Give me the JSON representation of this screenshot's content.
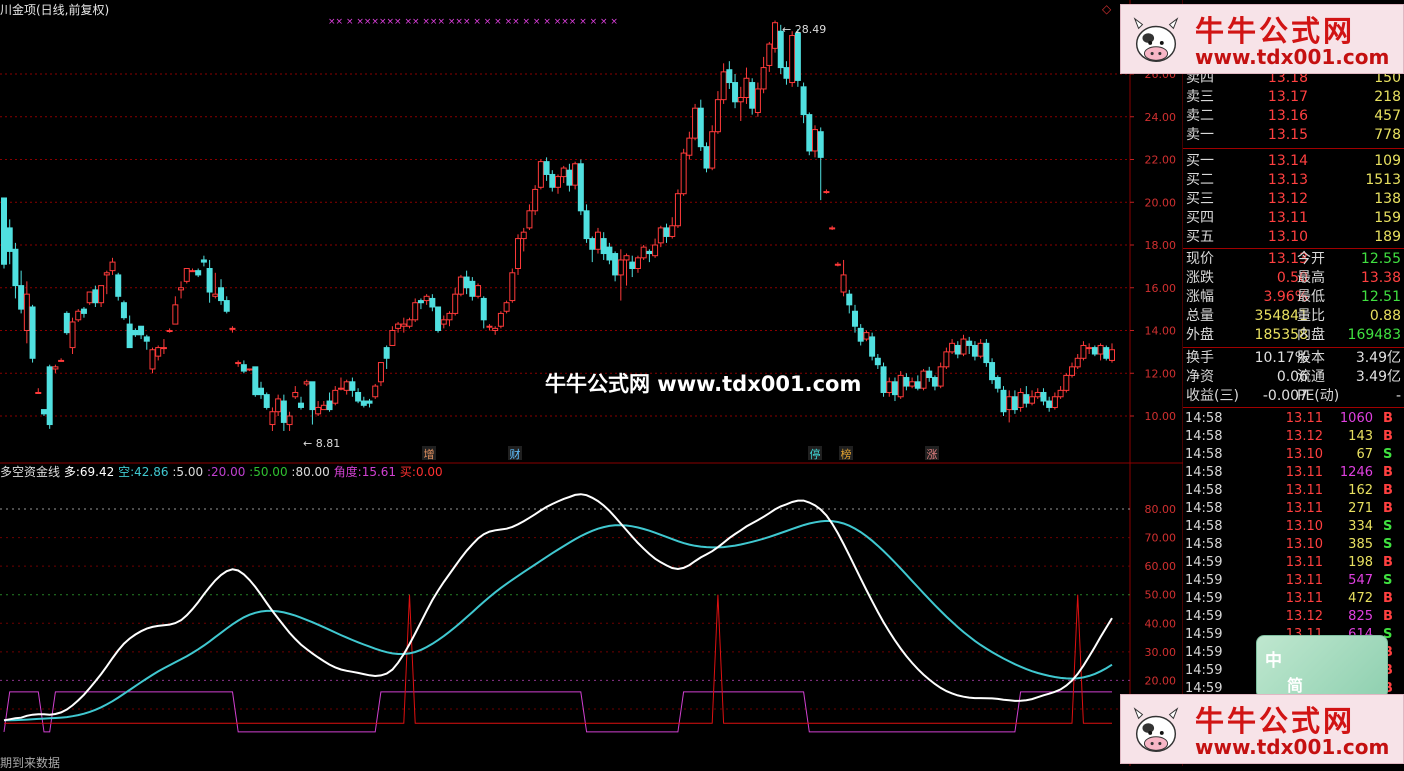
{
  "header": {
    "title": "川金项(日线,前复权)"
  },
  "main_chart": {
    "high_label": "28.49",
    "low_label": "8.81",
    "price_axis": [
      "26.00",
      "24.00",
      "22.00",
      "20.00",
      "18.00",
      "16.00",
      "14.00",
      "12.00",
      "10.00"
    ],
    "event_markers": [
      "增",
      "财",
      "停",
      "榜",
      "涨"
    ],
    "top_markers": "×× × ×××××× ×× ××× ××× × × × ×× × × × ××× × × × ×",
    "candles": [
      [
        20.2,
        17.1,
        20.2,
        16.9
      ],
      [
        18.8,
        17.7,
        19.2,
        17.1
      ],
      [
        17.8,
        16.1,
        18.1,
        15.5
      ],
      [
        16.1,
        15.0,
        16.8,
        14.8
      ],
      [
        14.0,
        15.7,
        16.3,
        13.4
      ],
      [
        15.1,
        12.7,
        15.2,
        12.5
      ],
      [
        11.1,
        11.1,
        11.3,
        11.1
      ],
      [
        10.3,
        10.1,
        10.3,
        10.0
      ],
      [
        12.3,
        9.6,
        12.4,
        9.4
      ],
      [
        12.2,
        12.3,
        12.4,
        12.0
      ],
      [
        12.6,
        12.6,
        12.7,
        12.6
      ],
      [
        14.8,
        13.9,
        14.9,
        13.8
      ],
      [
        13.2,
        14.4,
        14.6,
        12.9
      ],
      [
        14.5,
        14.9,
        15.0,
        14.4
      ],
      [
        15.0,
        14.8,
        15.1,
        14.6
      ],
      [
        15.3,
        15.8,
        15.8,
        15.2
      ],
      [
        15.9,
        15.3,
        16.1,
        15.1
      ],
      [
        15.3,
        16.1,
        16.1,
        15.1
      ],
      [
        16.6,
        16.7,
        16.8,
        15.7
      ],
      [
        16.8,
        17.2,
        17.4,
        16.6
      ],
      [
        16.6,
        15.6,
        16.7,
        15.4
      ],
      [
        15.3,
        14.6,
        15.4,
        14.5
      ],
      [
        14.3,
        13.2,
        14.7,
        13.2
      ],
      [
        14.0,
        13.8,
        14.1,
        13.7
      ],
      [
        14.2,
        13.8,
        14.2,
        13.6
      ],
      [
        13.7,
        13.5,
        13.8,
        13.1
      ],
      [
        12.2,
        13.1,
        13.2,
        12.0
      ],
      [
        12.8,
        13.2,
        13.3,
        12.6
      ],
      [
        13.2,
        13.2,
        13.6,
        12.9
      ],
      [
        14.0,
        14.0,
        14.1,
        13.9
      ],
      [
        14.3,
        15.2,
        15.6,
        14.3
      ],
      [
        15.9,
        16.0,
        16.3,
        15.5
      ],
      [
        16.3,
        16.9,
        16.9,
        16.2
      ],
      [
        16.8,
        16.8,
        16.9,
        16.8
      ],
      [
        16.8,
        16.6,
        16.9,
        16.5
      ],
      [
        17.3,
        17.2,
        17.5,
        17.0
      ],
      [
        16.9,
        15.8,
        17.3,
        15.3
      ],
      [
        15.6,
        15.7,
        16.7,
        15.5
      ],
      [
        16.0,
        15.4,
        16.4,
        15.2
      ],
      [
        15.4,
        14.9,
        15.6,
        14.8
      ],
      [
        14.1,
        14.1,
        14.2,
        13.9
      ],
      [
        12.5,
        12.5,
        12.6,
        12.3
      ],
      [
        12.4,
        12.1,
        12.6,
        12.0
      ],
      [
        12.2,
        12.2,
        12.2,
        12.1
      ],
      [
        12.3,
        11.0,
        12.3,
        10.9
      ],
      [
        11.3,
        11.0,
        11.6,
        10.8
      ],
      [
        11.0,
        10.4,
        11.1,
        10.3
      ],
      [
        9.6,
        10.2,
        10.4,
        9.3
      ],
      [
        10.2,
        10.8,
        11.0,
        10.0
      ],
      [
        10.7,
        9.7,
        11.0,
        9.3
      ],
      [
        9.6,
        10.0,
        10.2,
        9.3
      ],
      [
        10.9,
        11.1,
        11.4,
        10.8
      ],
      [
        10.6,
        10.4,
        10.9,
        10.3
      ],
      [
        11.5,
        11.6,
        11.7,
        11.4
      ],
      [
        11.6,
        10.3,
        11.6,
        9.6
      ],
      [
        10.1,
        10.4,
        10.7,
        10.0
      ],
      [
        10.3,
        10.5,
        10.7,
        10.3
      ],
      [
        10.7,
        10.3,
        11.1,
        10.2
      ],
      [
        10.6,
        11.2,
        11.4,
        10.5
      ],
      [
        11.3,
        11.3,
        11.8,
        11.2
      ],
      [
        11.2,
        11.6,
        11.7,
        11.0
      ],
      [
        11.6,
        11.2,
        11.8,
        10.9
      ],
      [
        11.1,
        10.7,
        11.3,
        10.6
      ],
      [
        10.7,
        10.5,
        10.9,
        10.4
      ],
      [
        10.7,
        10.6,
        10.8,
        10.4
      ],
      [
        10.9,
        11.4,
        11.5,
        10.8
      ],
      [
        11.6,
        12.5,
        12.5,
        11.4
      ],
      [
        13.2,
        12.7,
        13.3,
        12.2
      ],
      [
        13.3,
        14.0,
        14.2,
        13.3
      ],
      [
        14.1,
        14.3,
        14.4,
        13.9
      ],
      [
        14.2,
        14.3,
        14.6,
        13.9
      ],
      [
        14.2,
        14.5,
        14.6,
        14.1
      ],
      [
        14.5,
        15.3,
        15.5,
        14.4
      ],
      [
        15.4,
        15.3,
        15.5,
        15.0
      ],
      [
        15.4,
        15.6,
        15.7,
        15.2
      ],
      [
        15.5,
        15.1,
        15.7,
        14.9
      ],
      [
        15.1,
        14.0,
        15.1,
        13.9
      ],
      [
        14.3,
        14.5,
        14.7,
        14.1
      ],
      [
        14.5,
        14.8,
        14.9,
        14.2
      ],
      [
        14.8,
        15.7,
        16.0,
        14.7
      ],
      [
        15.7,
        16.5,
        16.6,
        15.6
      ],
      [
        16.5,
        16.0,
        16.8,
        15.7
      ],
      [
        16.3,
        15.6,
        16.5,
        15.4
      ],
      [
        15.6,
        16.1,
        16.2,
        15.5
      ],
      [
        15.5,
        14.5,
        15.6,
        14.1
      ],
      [
        14.2,
        14.2,
        14.3,
        14.0
      ],
      [
        14.0,
        14.1,
        14.2,
        13.8
      ],
      [
        14.2,
        14.8,
        14.9,
        14.1
      ],
      [
        14.9,
        15.3,
        15.4,
        14.8
      ],
      [
        15.4,
        16.7,
        16.9,
        15.3
      ],
      [
        16.9,
        18.3,
        18.5,
        16.6
      ],
      [
        18.3,
        18.6,
        18.8,
        17.7
      ],
      [
        18.8,
        19.6,
        19.9,
        18.7
      ],
      [
        19.6,
        20.6,
        20.8,
        19.4
      ],
      [
        20.7,
        21.9,
        22.0,
        20.6
      ],
      [
        21.9,
        21.3,
        22.1,
        21.0
      ],
      [
        21.3,
        20.7,
        21.5,
        20.5
      ],
      [
        20.7,
        21.2,
        21.3,
        20.4
      ],
      [
        21.2,
        21.6,
        21.7,
        20.9
      ],
      [
        21.5,
        20.8,
        21.8,
        20.5
      ],
      [
        20.8,
        21.8,
        21.9,
        20.6
      ],
      [
        21.8,
        19.6,
        22.0,
        19.4
      ],
      [
        19.6,
        18.3,
        19.9,
        18.1
      ],
      [
        18.3,
        17.8,
        18.4,
        17.2
      ],
      [
        17.8,
        18.6,
        18.8,
        17.6
      ],
      [
        18.3,
        17.6,
        18.6,
        17.3
      ],
      [
        17.9,
        17.3,
        18.1,
        17.1
      ],
      [
        17.6,
        16.6,
        17.7,
        16.3
      ],
      [
        16.6,
        17.3,
        17.8,
        15.4
      ],
      [
        17.3,
        17.5,
        17.6,
        16.1
      ],
      [
        17.2,
        16.9,
        17.5,
        16.5
      ],
      [
        16.9,
        17.4,
        17.5,
        16.7
      ],
      [
        17.4,
        17.9,
        18.0,
        17.3
      ],
      [
        17.7,
        17.6,
        17.8,
        17.2
      ],
      [
        17.5,
        18.0,
        18.3,
        17.4
      ],
      [
        18.1,
        18.8,
        18.9,
        17.9
      ],
      [
        18.8,
        18.4,
        19.0,
        18.1
      ],
      [
        18.4,
        18.9,
        19.3,
        18.3
      ],
      [
        18.9,
        20.4,
        20.6,
        18.8
      ],
      [
        20.4,
        22.3,
        22.5,
        20.3
      ],
      [
        22.2,
        23.0,
        23.3,
        22.0
      ],
      [
        23.0,
        24.4,
        24.6,
        22.9
      ],
      [
        24.4,
        22.6,
        24.8,
        22.4
      ],
      [
        22.6,
        21.6,
        22.8,
        21.4
      ],
      [
        21.6,
        23.3,
        23.6,
        21.5
      ],
      [
        23.3,
        24.8,
        25.2,
        23.2
      ],
      [
        24.8,
        26.1,
        26.5,
        24.6
      ],
      [
        26.2,
        25.6,
        26.6,
        25.3
      ],
      [
        25.6,
        24.7,
        26.0,
        24.4
      ],
      [
        24.7,
        24.9,
        25.4,
        23.8
      ],
      [
        24.9,
        25.8,
        26.3,
        24.6
      ],
      [
        25.6,
        24.4,
        25.8,
        24.1
      ],
      [
        24.2,
        25.3,
        25.6,
        24.0
      ],
      [
        25.3,
        26.3,
        26.8,
        25.1
      ],
      [
        26.4,
        27.4,
        27.5,
        26.1
      ],
      [
        27.2,
        28.4,
        28.5,
        27.0
      ],
      [
        28.0,
        26.3,
        28.3,
        26.0
      ],
      [
        26.3,
        25.8,
        26.6,
        25.5
      ],
      [
        25.6,
        27.8,
        28.0,
        25.4
      ],
      [
        27.9,
        25.7,
        28.1,
        25.4
      ],
      [
        25.4,
        24.1,
        25.6,
        23.7
      ],
      [
        24.1,
        22.4,
        24.2,
        22.2
      ],
      [
        22.4,
        23.4,
        23.6,
        22.1
      ],
      [
        23.3,
        22.1,
        23.5,
        20.1
      ],
      [
        20.5,
        20.5,
        20.6,
        20.4
      ],
      [
        18.8,
        18.8,
        18.9,
        18.7
      ],
      [
        17.1,
        17.1,
        17.2,
        17.0
      ],
      [
        15.8,
        16.6,
        17.3,
        15.6
      ],
      [
        15.7,
        15.2,
        15.9,
        14.8
      ],
      [
        14.9,
        14.2,
        15.2,
        13.9
      ],
      [
        14.1,
        13.5,
        14.3,
        13.3
      ],
      [
        13.6,
        13.9,
        14.0,
        13.5
      ],
      [
        13.7,
        12.8,
        13.9,
        12.6
      ],
      [
        12.7,
        12.4,
        12.9,
        12.2
      ],
      [
        12.3,
        11.1,
        12.5,
        10.9
      ],
      [
        11.1,
        11.6,
        11.8,
        10.9
      ],
      [
        11.6,
        11.0,
        11.8,
        10.7
      ],
      [
        10.9,
        11.9,
        12.1,
        10.8
      ],
      [
        11.8,
        11.4,
        12.0,
        11.2
      ],
      [
        11.4,
        11.6,
        11.8,
        11.3
      ],
      [
        11.6,
        11.3,
        11.9,
        11.2
      ],
      [
        11.3,
        12.1,
        12.2,
        11.2
      ],
      [
        12.1,
        11.8,
        12.3,
        11.6
      ],
      [
        11.8,
        11.4,
        11.9,
        11.2
      ],
      [
        11.4,
        12.3,
        12.5,
        11.3
      ],
      [
        12.3,
        13.0,
        13.2,
        12.2
      ],
      [
        13.0,
        13.4,
        13.6,
        12.9
      ],
      [
        13.3,
        12.9,
        13.5,
        12.7
      ],
      [
        12.9,
        13.6,
        13.8,
        12.8
      ],
      [
        13.5,
        13.3,
        13.7,
        12.9
      ],
      [
        13.3,
        12.8,
        13.5,
        12.6
      ],
      [
        12.8,
        13.4,
        13.6,
        12.7
      ],
      [
        13.4,
        12.5,
        13.6,
        12.3
      ],
      [
        12.5,
        11.7,
        12.7,
        11.5
      ],
      [
        11.8,
        11.3,
        11.9,
        11.1
      ],
      [
        11.2,
        10.2,
        11.4,
        10.0
      ],
      [
        10.3,
        10.9,
        11.2,
        9.7
      ],
      [
        10.9,
        10.3,
        11.2,
        10.1
      ],
      [
        10.4,
        11.1,
        11.3,
        10.2
      ],
      [
        11.0,
        10.6,
        11.4,
        10.4
      ],
      [
        10.6,
        10.9,
        11.2,
        10.5
      ],
      [
        10.9,
        11.1,
        11.3,
        10.8
      ],
      [
        11.1,
        10.7,
        11.3,
        10.5
      ],
      [
        10.7,
        10.4,
        10.9,
        10.2
      ],
      [
        10.4,
        10.9,
        11.1,
        10.3
      ],
      [
        10.9,
        11.2,
        11.4,
        10.8
      ],
      [
        11.2,
        11.9,
        12.0,
        11.1
      ],
      [
        11.9,
        12.3,
        12.5,
        11.8
      ],
      [
        12.3,
        12.7,
        12.9,
        12.2
      ],
      [
        12.7,
        13.3,
        13.5,
        12.6
      ],
      [
        13.2,
        13.2,
        13.4,
        12.9
      ],
      [
        13.2,
        12.9,
        13.3,
        12.8
      ],
      [
        12.9,
        13.3,
        13.4,
        12.6
      ],
      [
        13.2,
        12.7,
        13.3,
        12.6
      ],
      [
        12.6,
        13.1,
        13.4,
        12.5
      ]
    ]
  },
  "indicator": {
    "name": "多空资金线",
    "duo_label": "多",
    "duo_value": "69.42",
    "kong_label": "空",
    "kong_value": "42.86",
    "l1": "5.00",
    "l2": "20.00",
    "l3": "50.00",
    "l4": "80.00",
    "angle_label": "角度",
    "angle_value": "15.61",
    "buy_label": "买",
    "buy_value": "0.00",
    "axis": [
      "80.00",
      "70.00",
      "60.00",
      "50.00",
      "40.00",
      "30.00",
      "20.00",
      "10.00"
    ],
    "bottom_text": "期到来数据"
  },
  "quote_panel": {
    "sell": [
      {
        "label": "卖四",
        "price": "13.18",
        "vol": "150"
      },
      {
        "label": "卖三",
        "price": "13.17",
        "vol": "218"
      },
      {
        "label": "卖二",
        "price": "13.16",
        "vol": "457"
      },
      {
        "label": "卖一",
        "price": "13.15",
        "vol": "778"
      }
    ],
    "buy": [
      {
        "label": "买一",
        "price": "13.14",
        "vol": "109"
      },
      {
        "label": "买二",
        "price": "13.13",
        "vol": "1513"
      },
      {
        "label": "买三",
        "price": "13.12",
        "vol": "138"
      },
      {
        "label": "买四",
        "price": "13.11",
        "vol": "159"
      },
      {
        "label": "买五",
        "price": "13.10",
        "vol": "189"
      }
    ],
    "stats": [
      {
        "l1": "现价",
        "v1": "13.13",
        "l2": "今开",
        "v2": "12.55"
      },
      {
        "l1": "涨跌",
        "v1": "0.50",
        "l2": "最高",
        "v2": "13.38"
      },
      {
        "l1": "涨幅",
        "v1": "3.96%",
        "l2": "最低",
        "v2": "12.51"
      },
      {
        "l1": "总量",
        "v1": "354841",
        "l2": "量比",
        "v2": "0.88"
      },
      {
        "l1": "外盘",
        "v1": "185358",
        "l2": "内盘",
        "v2": "169483"
      }
    ],
    "stats2": [
      {
        "l1": "换手",
        "v1": "10.17%",
        "l2": "股本",
        "v2": "3.49亿"
      },
      {
        "l1": "净资",
        "v1": "0.06",
        "l2": "流通",
        "v2": "3.49亿"
      },
      {
        "l1": "收益(三)",
        "v1": "-0.007",
        "l2": "PE(动)",
        "v2": "-"
      }
    ],
    "ticks": [
      {
        "t": "14:58",
        "p": "13.11",
        "v": "1060",
        "s": "B"
      },
      {
        "t": "14:58",
        "p": "13.12",
        "v": "143",
        "s": "B"
      },
      {
        "t": "14:58",
        "p": "13.10",
        "v": "67",
        "s": "S"
      },
      {
        "t": "14:58",
        "p": "13.11",
        "v": "1246",
        "s": "B"
      },
      {
        "t": "14:58",
        "p": "13.11",
        "v": "162",
        "s": "B"
      },
      {
        "t": "14:58",
        "p": "13.11",
        "v": "271",
        "s": "B"
      },
      {
        "t": "14:58",
        "p": "13.10",
        "v": "334",
        "s": "S"
      },
      {
        "t": "14:58",
        "p": "13.10",
        "v": "385",
        "s": "S"
      },
      {
        "t": "14:59",
        "p": "13.11",
        "v": "198",
        "s": "B"
      },
      {
        "t": "14:59",
        "p": "13.11",
        "v": "547",
        "s": "S"
      },
      {
        "t": "14:59",
        "p": "13.11",
        "v": "472",
        "s": "B"
      },
      {
        "t": "14:59",
        "p": "13.12",
        "v": "825",
        "s": "B"
      },
      {
        "t": "14:59",
        "p": "13.11",
        "v": "614",
        "s": "S"
      },
      {
        "t": "14:59",
        "p": "",
        "v": "",
        "s": "B"
      },
      {
        "t": "14:59",
        "p": "",
        "v": "",
        "s": "B"
      },
      {
        "t": "14:59",
        "p": "",
        "v": "",
        "s": "B"
      }
    ]
  },
  "watermark": {
    "center_text": "牛牛公式网 www.tdx001.com",
    "brand": "牛牛公式网",
    "url": "www.tdx001.com",
    "widget_line1": "中",
    "widget_line2": "简"
  },
  "colors": {
    "up": "#ff3a3a",
    "down": "#50e0e0",
    "grid": "#8a0000",
    "duo_line": "#ffffff",
    "kong_line": "#40c8d0",
    "buy_signal": "#dd1010",
    "angle_line": "#d040d0"
  }
}
